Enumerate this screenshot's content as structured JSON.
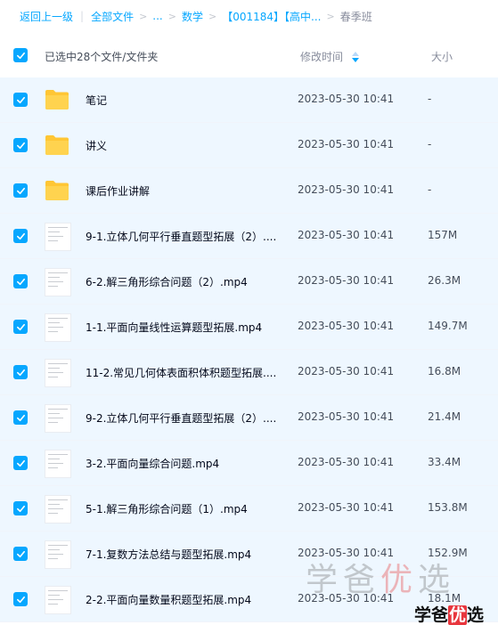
{
  "breadcrumb": {
    "back": "返回上一级",
    "root": "全部文件",
    "ellipsis": "...",
    "crumb1": "数学",
    "crumb2": "【001184】【高中...",
    "current": "春季班",
    "separator": ">",
    "divider": "|"
  },
  "header": {
    "selected": "已选中28个文件/文件夹",
    "time": "修改时间",
    "size": "大小"
  },
  "colors": {
    "accent": "#06a7ff",
    "row_selected_bg": "#eef7ff",
    "folder": "#ffc634"
  },
  "files": [
    {
      "type": "folder",
      "name": "笔记",
      "time": "2023-05-30 10:41",
      "size": "-"
    },
    {
      "type": "folder",
      "name": "讲义",
      "time": "2023-05-30 10:41",
      "size": "-"
    },
    {
      "type": "folder",
      "name": "课后作业讲解",
      "time": "2023-05-30 10:41",
      "size": "-"
    },
    {
      "type": "video",
      "name": "9-1.立体几何平行垂直题型拓展（2）....",
      "time": "2023-05-30 10:41",
      "size": "157M"
    },
    {
      "type": "video",
      "name": "6-2.解三角形综合问题（2）.mp4",
      "time": "2023-05-30 10:41",
      "size": "26.3M"
    },
    {
      "type": "video",
      "name": "1-1.平面向量线性运算题型拓展.mp4",
      "time": "2023-05-30 10:41",
      "size": "149.7M"
    },
    {
      "type": "video",
      "name": "11-2.常见几何体表面积体积题型拓展....",
      "time": "2023-05-30 10:41",
      "size": "16.8M"
    },
    {
      "type": "video",
      "name": "9-2.立体几何平行垂直题型拓展（2）....",
      "time": "2023-05-30 10:41",
      "size": "21.4M"
    },
    {
      "type": "video",
      "name": "3-2.平面向量综合问题.mp4",
      "time": "2023-05-30 10:41",
      "size": "33.4M"
    },
    {
      "type": "video",
      "name": "5-1.解三角形综合问题（1）.mp4",
      "time": "2023-05-30 10:41",
      "size": "153.8M"
    },
    {
      "type": "video",
      "name": "7-1.复数方法总结与题型拓展.mp4",
      "time": "2023-05-30 10:41",
      "size": "152.9M"
    },
    {
      "type": "video",
      "name": "2-2.平面向量数量积题型拓展.mp4",
      "time": "2023-05-30 10:41",
      "size": "18.1M"
    }
  ],
  "watermark": {
    "part1": "学爸",
    "part2": "优",
    "part3": "选"
  },
  "logo": {
    "part1": "学爸",
    "part2": "优",
    "part3": "选"
  }
}
